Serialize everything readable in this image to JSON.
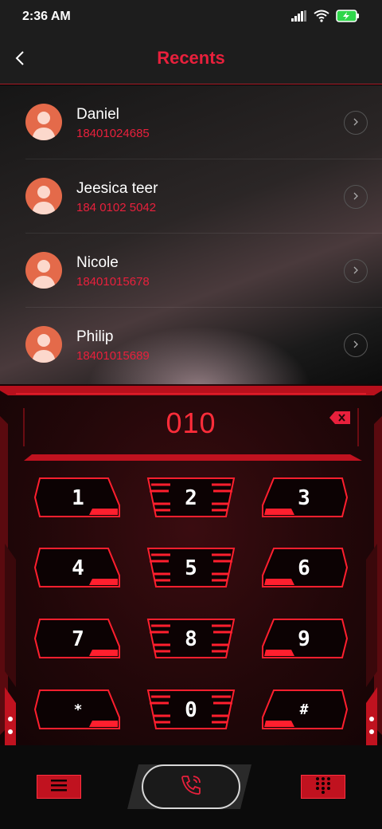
{
  "status": {
    "time": "2:36 AM"
  },
  "header": {
    "title": "Recents"
  },
  "contacts": [
    {
      "name": "Daniel",
      "number": "18401024685"
    },
    {
      "name": "Jeesica teer",
      "number": "184 0102 5042"
    },
    {
      "name": "Nicole",
      "number": "18401015678"
    },
    {
      "name": "Philip",
      "number": "18401015689"
    }
  ],
  "dialer": {
    "display": "010",
    "keys": [
      "1",
      "2",
      "3",
      "4",
      "5",
      "6",
      "7",
      "8",
      "9",
      "*",
      "0",
      "#"
    ]
  },
  "colors": {
    "accent": "#e8203c",
    "avatar": "#e46a4a",
    "key_red": "#ff1f2e"
  },
  "icons": {
    "back": "chevron-left-icon",
    "arrow": "chevron-right-icon",
    "backspace": "backspace-icon",
    "menu": "menu-icon",
    "call": "phone-icon",
    "keypad": "keypad-icon"
  }
}
